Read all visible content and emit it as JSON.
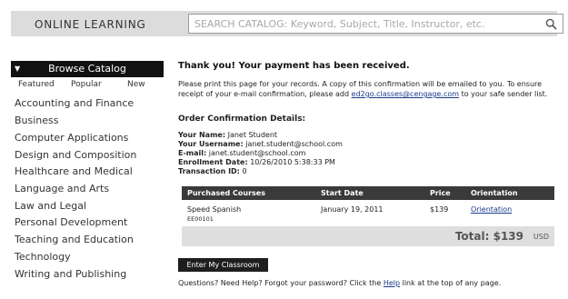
{
  "header": {
    "brand": "ONLINE LEARNING",
    "search_placeholder": "SEARCH CATALOG: Keyword, Subject, Title, Instructor, etc."
  },
  "sidebar": {
    "title": "Browse Catalog",
    "tabs": [
      "Featured",
      "Popular",
      "New"
    ],
    "categories": [
      "Accounting and Finance",
      "Business",
      "Computer Applications",
      "Design and Composition",
      "Healthcare and Medical",
      "Language and Arts",
      "Law and Legal",
      "Personal Development",
      "Teaching and Education",
      "Technology",
      "Writing and Publishing"
    ]
  },
  "main": {
    "heading": "Thank you! Your payment has been received.",
    "intro_before_link": "Please print this page for your records. A copy of this confirmation will be emailed to you. To ensure receipt of your e-mail confirmation, please add ",
    "email_link": "ed2go.classes@cengage.com",
    "intro_after_link": " to your safe sender list.",
    "details_heading": "Order Confirmation Details:",
    "details": {
      "name_label": "Your Name:",
      "name_value": "Janet Student",
      "username_label": "Your Username:",
      "username_value": "janet.student@school.com",
      "email_label": "E-mail:",
      "email_value": "janet.student@school.com",
      "date_label": "Enrollment Date:",
      "date_value": "10/26/2010 5:38:33 PM",
      "txn_label": "Transaction ID:",
      "txn_value": "0"
    },
    "table": {
      "headers": [
        "Purchased Courses",
        "Start Date",
        "Price",
        "Orientation"
      ],
      "row": {
        "course": "Speed Spanish",
        "code": "EE00101",
        "start": "January 19, 2011",
        "price": "$139",
        "orientation": "Orientation"
      },
      "total_label": "Total: $139",
      "total_currency": "USD"
    },
    "button": "Enter My Classroom",
    "footer_before": "Questions? Need Help? Forgot your password? Click the ",
    "footer_link": "Help",
    "footer_after": " link at the top of any page."
  }
}
